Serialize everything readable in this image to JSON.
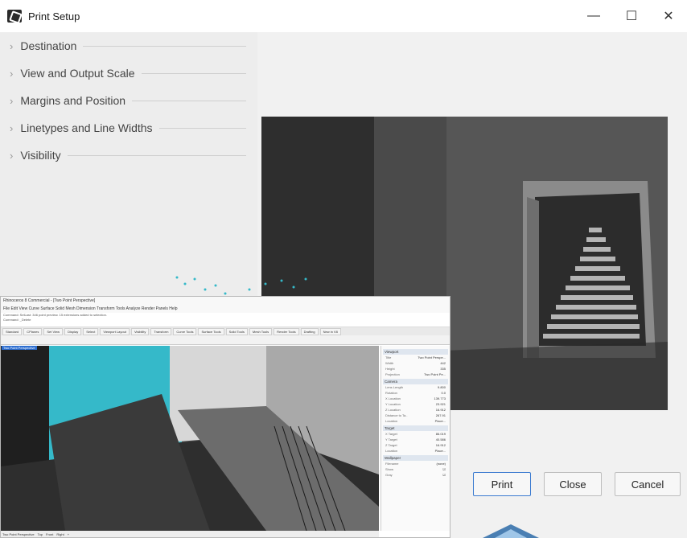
{
  "window": {
    "title": "Print Setup",
    "controls": {
      "minimize": "—",
      "maximize": "☐",
      "close": "✕"
    }
  },
  "sections": [
    {
      "label": "Destination"
    },
    {
      "label": "View and Output Scale"
    },
    {
      "label": "Margins and Position"
    },
    {
      "label": "Linetypes and Line Widths"
    },
    {
      "label": "Visibility"
    }
  ],
  "buttons": {
    "print": "Print",
    "close": "Close",
    "cancel": "Cancel"
  },
  "colors": {
    "accent": "#3b7bd0",
    "cyan": "#35b9c9",
    "dark": "#3c3c3c"
  },
  "overlay": {
    "title": "Rhinoceros 8 Commercial - [Two Point Perspective]",
    "menu": "File  Edit  View  Curve  Surface  Solid  Mesh  Dimension  Transform  Tools  Analyze  Render  Panels  Help",
    "command_lines": [
      "Command: SelLast: 346 point preview. 15 extensions added to selection.",
      "Command: _Delete"
    ],
    "tabs": [
      "Standard",
      "CPlanes",
      "Set View",
      "Display",
      "Select",
      "Viewport Layout",
      "Visibility",
      "Transform",
      "Curve Tools",
      "Surface Tools",
      "Solid Tools",
      "Mesh Tools",
      "Render Tools",
      "Drafting",
      "New in V8"
    ],
    "viewport_label": "Two Point Perspective",
    "panel": {
      "viewport_header": "Viewport",
      "viewport_rows": [
        {
          "k": "Title",
          "v": "Two Point Perspe..."
        },
        {
          "k": "Width",
          "v": "442"
        },
        {
          "k": "Height",
          "v": "335"
        },
        {
          "k": "Projection",
          "v": "Two Point Pe..."
        }
      ],
      "camera_header": "Camera",
      "camera_rows": [
        {
          "k": "Lens Length",
          "v": "9.800"
        },
        {
          "k": "Rotation",
          "v": "0.0"
        },
        {
          "k": "X Location",
          "v": "139.773"
        },
        {
          "k": "Y Location",
          "v": "23.921"
        },
        {
          "k": "Z Location",
          "v": "16.912"
        },
        {
          "k": "Distance to Ta..",
          "v": "267.91"
        },
        {
          "k": "Location",
          "v": "Place..."
        }
      ],
      "target_header": "Target",
      "target_rows": [
        {
          "k": "X Target",
          "v": "86.019"
        },
        {
          "k": "Y Target",
          "v": "40.586"
        },
        {
          "k": "Z Target",
          "v": "16.912"
        },
        {
          "k": "Location",
          "v": "Place..."
        }
      ],
      "wallpaper_header": "Wallpaper",
      "wallpaper_rows": [
        {
          "k": "Filename",
          "v": "(none)"
        },
        {
          "k": "Show",
          "v": "☑"
        },
        {
          "k": "Gray",
          "v": "☑"
        }
      ]
    },
    "status_tabs": [
      "Two Point Perspective",
      "Top",
      "Front",
      "Right",
      "+"
    ]
  }
}
